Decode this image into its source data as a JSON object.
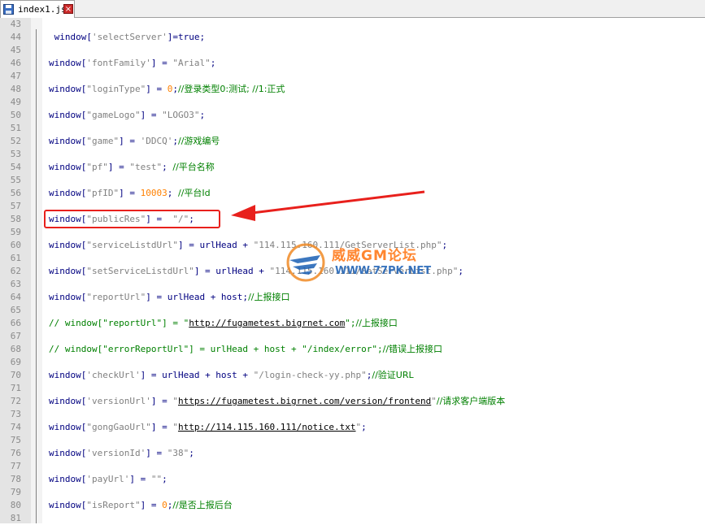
{
  "tab": {
    "filename": "index1.js",
    "close_glyph": "×"
  },
  "lines": [
    {
      "n": "43",
      "parts": []
    },
    {
      "n": "44",
      "parts": [
        {
          "t": " window[",
          "c": "kw"
        },
        {
          "t": "'selectServer'",
          "c": "str"
        },
        {
          "t": "]=true;",
          "c": "kw"
        }
      ]
    },
    {
      "n": "45",
      "parts": []
    },
    {
      "n": "46",
      "parts": [
        {
          "t": "window[",
          "c": "kw"
        },
        {
          "t": "'fontFamily'",
          "c": "str"
        },
        {
          "t": "] = ",
          "c": "kw"
        },
        {
          "t": "\"Arial\"",
          "c": "str"
        },
        {
          "t": ";",
          "c": "kw"
        }
      ]
    },
    {
      "n": "47",
      "parts": []
    },
    {
      "n": "48",
      "parts": [
        {
          "t": "window[",
          "c": "kw"
        },
        {
          "t": "\"loginType\"",
          "c": "str"
        },
        {
          "t": "] = ",
          "c": "kw"
        },
        {
          "t": "0",
          "c": "num"
        },
        {
          "t": ";",
          "c": "kw"
        },
        {
          "t": "//登录类型0:测试; //1:正式",
          "c": "cmt cn"
        }
      ]
    },
    {
      "n": "49",
      "parts": []
    },
    {
      "n": "50",
      "parts": [
        {
          "t": "window[",
          "c": "kw"
        },
        {
          "t": "\"gameLogo\"",
          "c": "str"
        },
        {
          "t": "] = ",
          "c": "kw"
        },
        {
          "t": "\"LOGO3\"",
          "c": "str"
        },
        {
          "t": ";",
          "c": "kw"
        }
      ]
    },
    {
      "n": "51",
      "parts": []
    },
    {
      "n": "52",
      "parts": [
        {
          "t": "window[",
          "c": "kw"
        },
        {
          "t": "\"game\"",
          "c": "str"
        },
        {
          "t": "] = ",
          "c": "kw"
        },
        {
          "t": "'DDCQ'",
          "c": "str"
        },
        {
          "t": ";",
          "c": "kw"
        },
        {
          "t": "//游戏编号",
          "c": "cmt cn"
        }
      ]
    },
    {
      "n": "53",
      "parts": []
    },
    {
      "n": "54",
      "parts": [
        {
          "t": "window[",
          "c": "kw"
        },
        {
          "t": "\"pf\"",
          "c": "str"
        },
        {
          "t": "] = ",
          "c": "kw"
        },
        {
          "t": "\"test\"",
          "c": "str"
        },
        {
          "t": "; ",
          "c": "kw"
        },
        {
          "t": "//平台名称",
          "c": "cmt cn"
        }
      ]
    },
    {
      "n": "55",
      "parts": []
    },
    {
      "n": "56",
      "parts": [
        {
          "t": "window[",
          "c": "kw"
        },
        {
          "t": "\"pfID\"",
          "c": "str"
        },
        {
          "t": "] = ",
          "c": "kw"
        },
        {
          "t": "10003",
          "c": "num"
        },
        {
          "t": "; ",
          "c": "kw"
        },
        {
          "t": "//平台Id",
          "c": "cmt cn"
        }
      ]
    },
    {
      "n": "57",
      "parts": []
    },
    {
      "n": "58",
      "parts": [
        {
          "t": "window[",
          "c": "kw"
        },
        {
          "t": "\"publicRes\"",
          "c": "str"
        },
        {
          "t": "] =  ",
          "c": "kw"
        },
        {
          "t": "\"/\"",
          "c": "str"
        },
        {
          "t": ";",
          "c": "kw"
        }
      ]
    },
    {
      "n": "59",
      "parts": []
    },
    {
      "n": "60",
      "parts": [
        {
          "t": "window[",
          "c": "kw"
        },
        {
          "t": "\"serviceListdUrl\"",
          "c": "str"
        },
        {
          "t": "] = urlHead + ",
          "c": "kw"
        },
        {
          "t": "\"114.115.160.111/GetServerList.php\"",
          "c": "str"
        },
        {
          "t": ";",
          "c": "kw"
        }
      ]
    },
    {
      "n": "61",
      "parts": []
    },
    {
      "n": "62",
      "parts": [
        {
          "t": "window[",
          "c": "kw"
        },
        {
          "t": "\"setServiceListdUrl\"",
          "c": "str"
        },
        {
          "t": "] = urlHead + ",
          "c": "kw"
        },
        {
          "t": "\"114.115.160.111/SetServerList.php\"",
          "c": "str"
        },
        {
          "t": ";",
          "c": "kw"
        }
      ]
    },
    {
      "n": "63",
      "parts": []
    },
    {
      "n": "64",
      "parts": [
        {
          "t": "window[",
          "c": "kw"
        },
        {
          "t": "\"reportUrl\"",
          "c": "str"
        },
        {
          "t": "] = urlHead + host;",
          "c": "kw"
        },
        {
          "t": "//上报接口",
          "c": "cmt cn"
        }
      ]
    },
    {
      "n": "65",
      "parts": []
    },
    {
      "n": "66",
      "parts": [
        {
          "t": "// window[\"reportUrl\"] = \"",
          "c": "cmt"
        },
        {
          "t": "http://fugametest.bigrnet.com",
          "c": "url"
        },
        {
          "t": "\";",
          "c": "cmt"
        },
        {
          "t": "//上报接口",
          "c": "cmt cn"
        }
      ]
    },
    {
      "n": "67",
      "parts": []
    },
    {
      "n": "68",
      "parts": [
        {
          "t": "// window[\"errorReportUrl\"] = urlHead + host + \"/index/error\";",
          "c": "cmt"
        },
        {
          "t": "//错误上报接口",
          "c": "cmt cn"
        }
      ]
    },
    {
      "n": "69",
      "parts": []
    },
    {
      "n": "70",
      "parts": [
        {
          "t": "window[",
          "c": "kw"
        },
        {
          "t": "'checkUrl'",
          "c": "str"
        },
        {
          "t": "] = urlHead + host + ",
          "c": "kw"
        },
        {
          "t": "\"/login-check-yy.php\"",
          "c": "str"
        },
        {
          "t": ";",
          "c": "kw"
        },
        {
          "t": "//验证URL",
          "c": "cmt cn"
        }
      ]
    },
    {
      "n": "71",
      "parts": []
    },
    {
      "n": "72",
      "parts": [
        {
          "t": "window[",
          "c": "kw"
        },
        {
          "t": "'versionUrl'",
          "c": "str"
        },
        {
          "t": "] = ",
          "c": "kw"
        },
        {
          "t": "\"",
          "c": "str"
        },
        {
          "t": "https://fugametest.bigrnet.com/version/frontend",
          "c": "url"
        },
        {
          "t": "\"",
          "c": "str"
        },
        {
          "t": "//请求客户端版本",
          "c": "cmt cn"
        }
      ]
    },
    {
      "n": "73",
      "parts": []
    },
    {
      "n": "74",
      "parts": [
        {
          "t": "window[",
          "c": "kw"
        },
        {
          "t": "\"gongGaoUrl\"",
          "c": "str"
        },
        {
          "t": "] = ",
          "c": "kw"
        },
        {
          "t": "\"",
          "c": "str"
        },
        {
          "t": "http://114.115.160.111/notice.txt",
          "c": "url"
        },
        {
          "t": "\"",
          "c": "str"
        },
        {
          "t": ";",
          "c": "kw"
        }
      ]
    },
    {
      "n": "75",
      "parts": []
    },
    {
      "n": "76",
      "parts": [
        {
          "t": "window[",
          "c": "kw"
        },
        {
          "t": "'versionId'",
          "c": "str"
        },
        {
          "t": "] = ",
          "c": "kw"
        },
        {
          "t": "\"38\"",
          "c": "str"
        },
        {
          "t": ";",
          "c": "kw"
        }
      ]
    },
    {
      "n": "77",
      "parts": []
    },
    {
      "n": "78",
      "parts": [
        {
          "t": "window[",
          "c": "kw"
        },
        {
          "t": "'payUrl'",
          "c": "str"
        },
        {
          "t": "] = ",
          "c": "kw"
        },
        {
          "t": "\"\"",
          "c": "str"
        },
        {
          "t": ";",
          "c": "kw"
        }
      ]
    },
    {
      "n": "79",
      "parts": []
    },
    {
      "n": "80",
      "parts": [
        {
          "t": "window[",
          "c": "kw"
        },
        {
          "t": "\"isReport\"",
          "c": "str"
        },
        {
          "t": "] = ",
          "c": "kw"
        },
        {
          "t": "0",
          "c": "num"
        },
        {
          "t": ";",
          "c": "kw"
        },
        {
          "t": "//是否上报后台",
          "c": "cmt cn"
        }
      ]
    },
    {
      "n": "81",
      "parts": []
    }
  ],
  "annotation": {
    "highlight_line": "58",
    "arrow_color": "#e8201c"
  },
  "watermark": {
    "title": "威威GM论坛",
    "url": "WWW.77PK.NET"
  }
}
